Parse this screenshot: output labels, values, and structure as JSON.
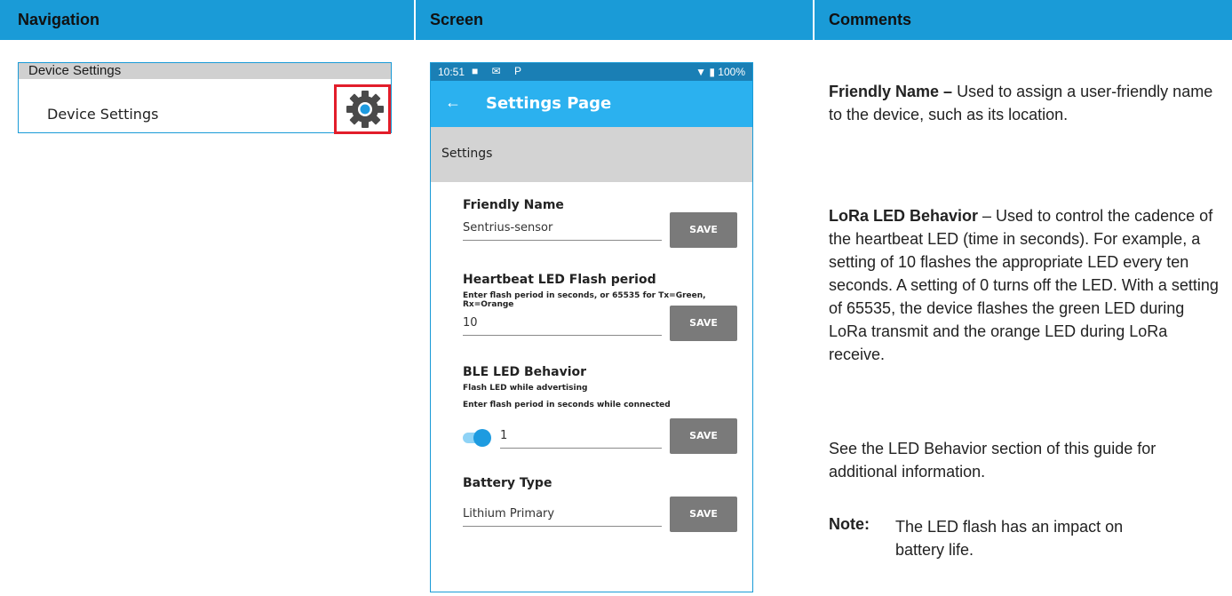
{
  "header": {
    "col1": "Navigation",
    "col2": "Screen",
    "col3": "Comments"
  },
  "nav": {
    "card_title": "Device Settings",
    "item_label": "Device Settings",
    "icon": "gear-icon"
  },
  "phone": {
    "status": {
      "time": "10:51",
      "icons": "■ ✉ P",
      "right": "▼ ▮ 100%"
    },
    "appbar": {
      "back": "←",
      "title": "Settings Page"
    },
    "band_label": "Settings",
    "friendly_name": {
      "title": "Friendly Name",
      "value": "Sentrius-sensor",
      "save": "SAVE"
    },
    "heartbeat": {
      "title": "Heartbeat LED Flash period",
      "help": "Enter flash period in seconds, or 65535 for Tx=Green, Rx=Orange",
      "value": "10",
      "save": "SAVE"
    },
    "ble": {
      "title": "BLE LED Behavior",
      "help1": "Flash LED while advertising",
      "help2": "Enter flash period in seconds while connected",
      "toggle_on": true,
      "value": "1",
      "save": "SAVE"
    },
    "battery": {
      "title": "Battery Type",
      "value": "Lithium Primary",
      "save": "SAVE"
    }
  },
  "comments": {
    "p1_bold": "Friendly Name –",
    "p1_text": " Used to assign a user-friendly name to the device, such as its location.",
    "p2_bold": "LoRa LED Behavior",
    "p2_text": " – Used to control the cadence of the heartbeat LED (time in seconds). For example, a setting of 10 flashes the appropriate LED every ten seconds. A setting of 0 turns off the LED. With a setting of 65535, the device flashes the green LED during LoRa transmit and the orange LED during LoRa receive.",
    "p3": "See the LED Behavior section of this guide for additional information.",
    "note_label": "Note:",
    "note_text": "The LED flash has an impact on battery life."
  },
  "colors": {
    "header": "#1a9bd7",
    "appbar": "#2bb1ef",
    "statusbar": "#1a7fb5",
    "highlight": "#e21d2a"
  }
}
